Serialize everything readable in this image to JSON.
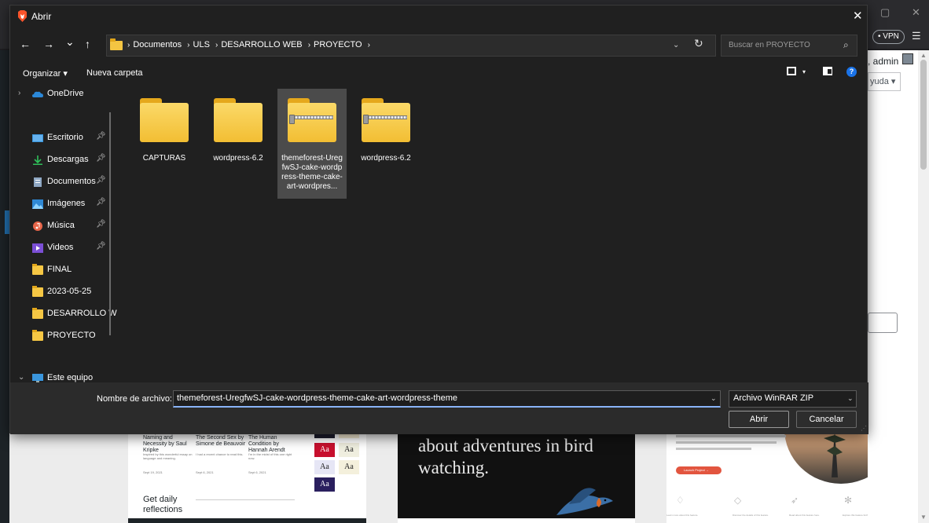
{
  "dialog": {
    "title": "Abrir",
    "close": "✕",
    "nav": {
      "back": "←",
      "forward": "→",
      "recent": "⌄",
      "up": "↑",
      "refresh": "↻",
      "dropdown": "⌄"
    },
    "breadcrumb": [
      "Documentos",
      "ULS",
      "DESARROLLO WEB",
      "PROYECTO"
    ],
    "search_placeholder": "Buscar en PROYECTO",
    "toolbar": {
      "organize": "Organizar",
      "new_folder": "Nueva carpeta",
      "help": "?"
    },
    "sidebar": [
      {
        "label": "OneDrive",
        "icon": "onedrive-icon",
        "pinned": false
      },
      {
        "label": "Escritorio",
        "icon": "desktop-icon",
        "pinned": true
      },
      {
        "label": "Descargas",
        "icon": "download-icon",
        "pinned": true
      },
      {
        "label": "Documentos",
        "icon": "document-icon",
        "pinned": true
      },
      {
        "label": "Imágenes",
        "icon": "pictures-icon",
        "pinned": true
      },
      {
        "label": "Música",
        "icon": "music-icon",
        "pinned": true
      },
      {
        "label": "Videos",
        "icon": "video-icon",
        "pinned": true
      },
      {
        "label": "FINAL",
        "icon": "folder-icon",
        "pinned": false
      },
      {
        "label": "2023-05-25",
        "icon": "folder-icon",
        "pinned": false
      },
      {
        "label": "DESARROLLO W",
        "icon": "folder-icon",
        "pinned": false
      },
      {
        "label": "PROYECTO",
        "icon": "folder-icon",
        "pinned": false
      },
      {
        "label": "Este equipo",
        "icon": "pc-icon",
        "pinned": false
      }
    ],
    "files": [
      {
        "name": "CAPTURAS",
        "type": "folder",
        "selected": false
      },
      {
        "name": "wordpress-6.2",
        "type": "folder",
        "selected": false
      },
      {
        "name": "themeforest-UregfwSJ-cake-wordpress-theme-cake-art-wordpres...",
        "type": "zip",
        "selected": true
      },
      {
        "name": "wordpress-6.2",
        "type": "zip",
        "selected": false
      }
    ],
    "filename_label": "Nombre de archivo:",
    "filename_value": "themeforest-UregfwSJ-cake-wordpress-theme-cake-art-wordpress-theme",
    "filetype_value": "Archivo WinRAR ZIP",
    "open_button": "Abrir",
    "cancel_button": "Cancelar"
  },
  "background": {
    "vpn_label": "• VPN",
    "admin_text": ", admin",
    "ayuda_text": "yuda ▾",
    "books": [
      {
        "title": "Naming and Necessity by Saul Kripke",
        "date": "Sept 19, 2021"
      },
      {
        "title": "The Second Sex by Simone de Beauvoir",
        "date": "Sept 6, 2021"
      },
      {
        "title": "The Human Condition by Hannah Arendt",
        "date": "Sept 6, 2021"
      }
    ],
    "aa_label": "Aa",
    "get_daily": "Get daily reflections",
    "bird_text": "about adventures in bird watching.",
    "launch_label": "Launch Project →"
  },
  "colors": {
    "accent": "#1a73e8",
    "folder": "#f6c744",
    "dialog_bg": "#202020"
  }
}
